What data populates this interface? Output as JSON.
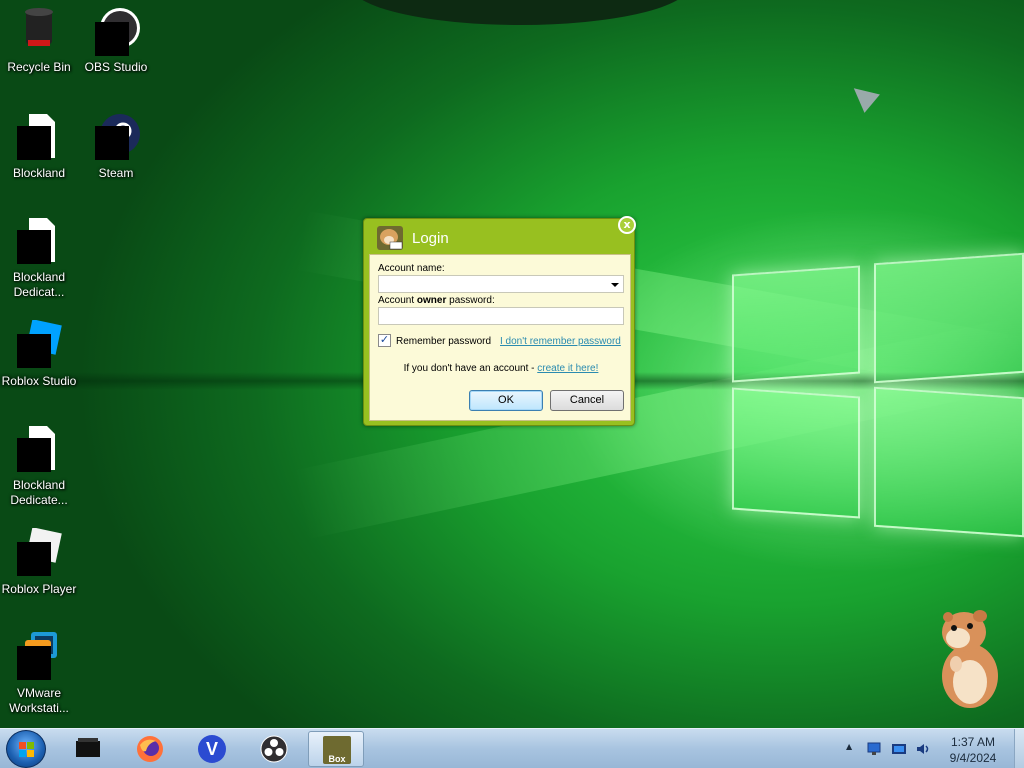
{
  "desktop": {
    "icons": [
      {
        "label": "Recycle Bin",
        "icon": "recycle-bin-icon"
      },
      {
        "label": "OBS Studio",
        "icon": "obs-studio-icon"
      },
      {
        "label": "Blockland",
        "icon": "blockland-icon"
      },
      {
        "label": "Steam",
        "icon": "steam-icon"
      },
      {
        "label": "Blockland Dedicat...",
        "icon": "blockland-dedicated-icon"
      },
      {
        "label": "Roblox Studio",
        "icon": "roblox-studio-icon"
      },
      {
        "label": "Blockland Dedicate...",
        "icon": "blockland-dedicated-icon"
      },
      {
        "label": "Roblox Player",
        "icon": "roblox-player-icon"
      },
      {
        "label": "VMware Workstati...",
        "icon": "vmware-workstation-icon"
      }
    ]
  },
  "login": {
    "title": "Login",
    "close_glyph": "x",
    "account_name_label": "Account name:",
    "account_name_value": "",
    "password_label_prefix": "Account ",
    "password_label_bold": "owner",
    "password_label_suffix": " password:",
    "password_value": "",
    "remember_label": "Remember password",
    "remember_checked": true,
    "forgot_link": "I don't remember password",
    "no_account_text": "If you don't have an account - ",
    "create_link": "create it here!",
    "ok_label": "OK",
    "cancel_label": "Cancel"
  },
  "taskbar": {
    "apps": [
      {
        "name": "start-button",
        "icon": "windows-start-icon"
      },
      {
        "name": "taskbar-app-blockland",
        "icon": "blockland-icon"
      },
      {
        "name": "taskbar-app-firefox",
        "icon": "firefox-icon"
      },
      {
        "name": "taskbar-app-v",
        "icon": "v-app-icon",
        "glyph": "V"
      },
      {
        "name": "taskbar-app-obs",
        "icon": "obs-studio-icon"
      },
      {
        "name": "taskbar-app-box",
        "icon": "box-hamster-icon",
        "glyph": "Box"
      }
    ],
    "clock": {
      "time": "1:37 AM",
      "date": "9/4/2024"
    },
    "tray_expand_glyph": "▲"
  },
  "colors": {
    "dialog_frame": "#98c020",
    "dialog_body": "#fcfad8",
    "link": "#2a8bb0",
    "taskbar": "#a8c4e0"
  }
}
